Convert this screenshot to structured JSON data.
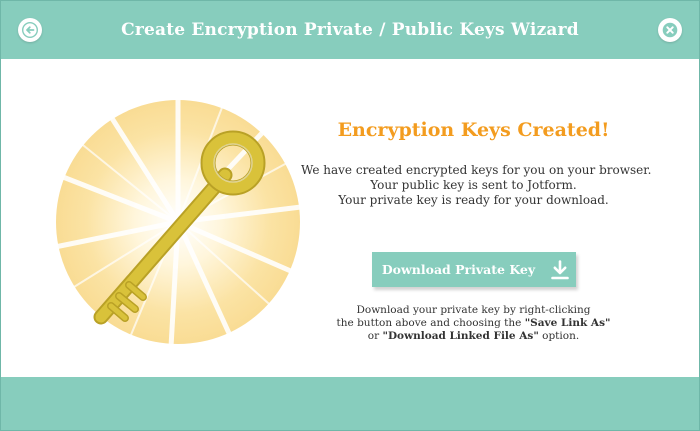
{
  "header": {
    "title": "Create Encryption Private / Public Keys Wizard",
    "back_icon": "back-arrow-icon",
    "close_icon": "close-icon"
  },
  "main": {
    "headline": "Encryption Keys Created!",
    "message_lines": [
      "We have created encrypted keys for you on your browser.",
      "Your public key is sent to Jotform.",
      "Your private key is ready for your download."
    ],
    "download_button": {
      "label": "Download Private Key",
      "icon": "download-icon"
    },
    "hint": {
      "line1": "Download your private key by right-clicking",
      "line2_prefix": "the button above and choosing the ",
      "line2_bold": "\"Save Link As\"",
      "line3_prefix": "or ",
      "line3_bold": "\"Download Linked File As\"",
      "line3_suffix": " option."
    },
    "illustration_icon": "key-icon"
  },
  "colors": {
    "header_bg": "#87cdbd",
    "headline": "#f39c1f",
    "button_bg": "#87cdbd",
    "key_gold": "#d9c23a"
  }
}
